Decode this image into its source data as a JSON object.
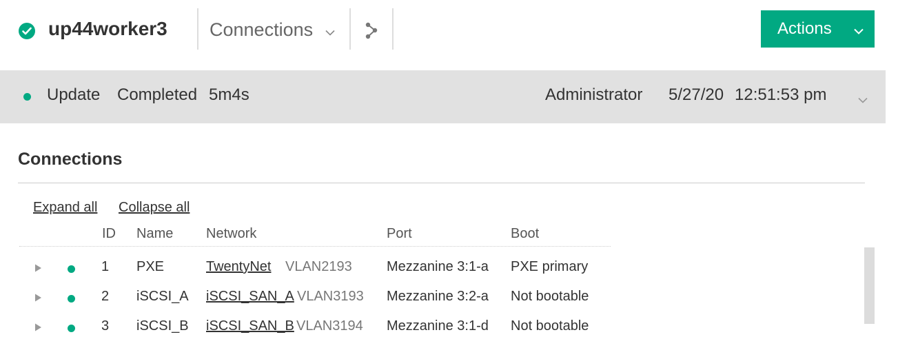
{
  "header": {
    "title": "up44worker3",
    "status": "ok",
    "view_label": "Connections",
    "actions_label": "Actions",
    "accent_color": "#01a982"
  },
  "activity": {
    "name": "Update",
    "state": "Completed",
    "duration": "5m4s",
    "user": "Administrator",
    "date": "5/27/20",
    "time": "12:51:53 pm"
  },
  "section": {
    "title": "Connections",
    "expand_all": "Expand all",
    "collapse_all": "Collapse all"
  },
  "table": {
    "columns": [
      "ID",
      "Name",
      "Network",
      "Port",
      "Boot"
    ],
    "rows": [
      {
        "id": "1",
        "name": "PXE",
        "network": "TwentyNet",
        "vlan": "VLAN2193",
        "port": "Mezzanine 3:1-a",
        "boot": "PXE primary",
        "status": "ok"
      },
      {
        "id": "2",
        "name": "iSCSI_A",
        "network": "iSCSI_SAN_A",
        "vlan": "VLAN3193",
        "port": "Mezzanine 3:2-a",
        "boot": "Not bootable",
        "status": "ok"
      },
      {
        "id": "3",
        "name": "iSCSI_B",
        "network": "iSCSI_SAN_B",
        "vlan": "VLAN3194",
        "port": "Mezzanine 3:1-d",
        "boot": "Not bootable",
        "status": "ok"
      }
    ]
  }
}
